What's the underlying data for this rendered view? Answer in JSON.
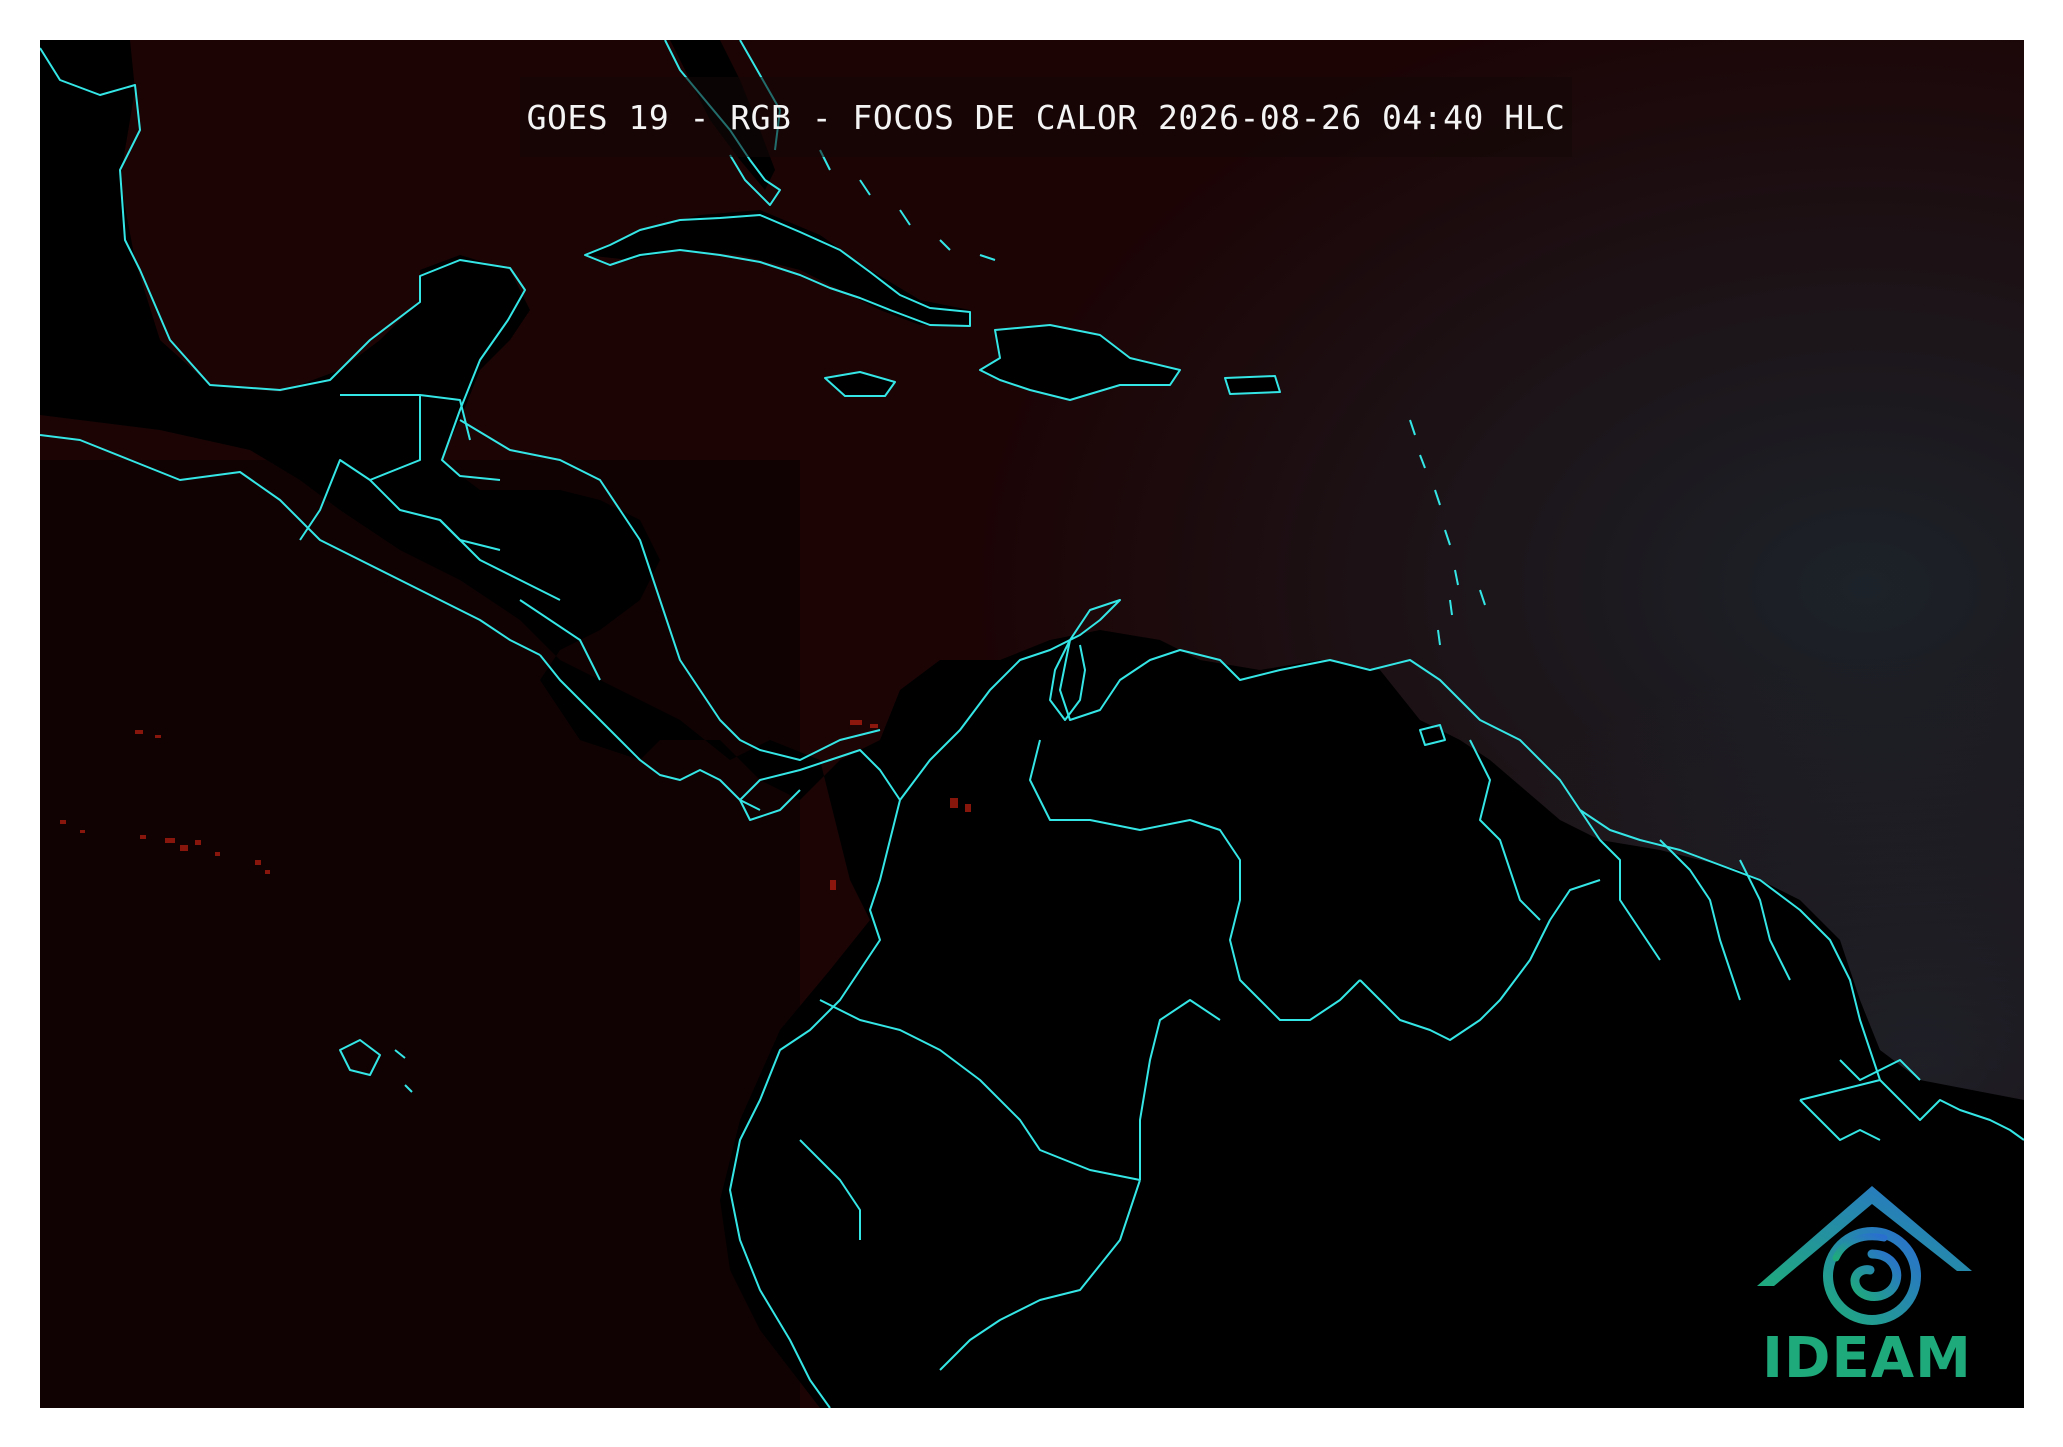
{
  "map": {
    "title": "GOES 19 - RGB - FOCOS DE CALOR 2026-08-26 04:40 HLC",
    "logo_name": "IDEAM",
    "colors": {
      "background": "#0c0203",
      "land": "#000000",
      "ocean": "#1c0405",
      "coastline": "#35e6e6",
      "hotspot": "#a81c10",
      "cloud": "#1a3a48",
      "logo_green": "#1faa7c",
      "logo_blue": "#2a6fd0"
    }
  }
}
